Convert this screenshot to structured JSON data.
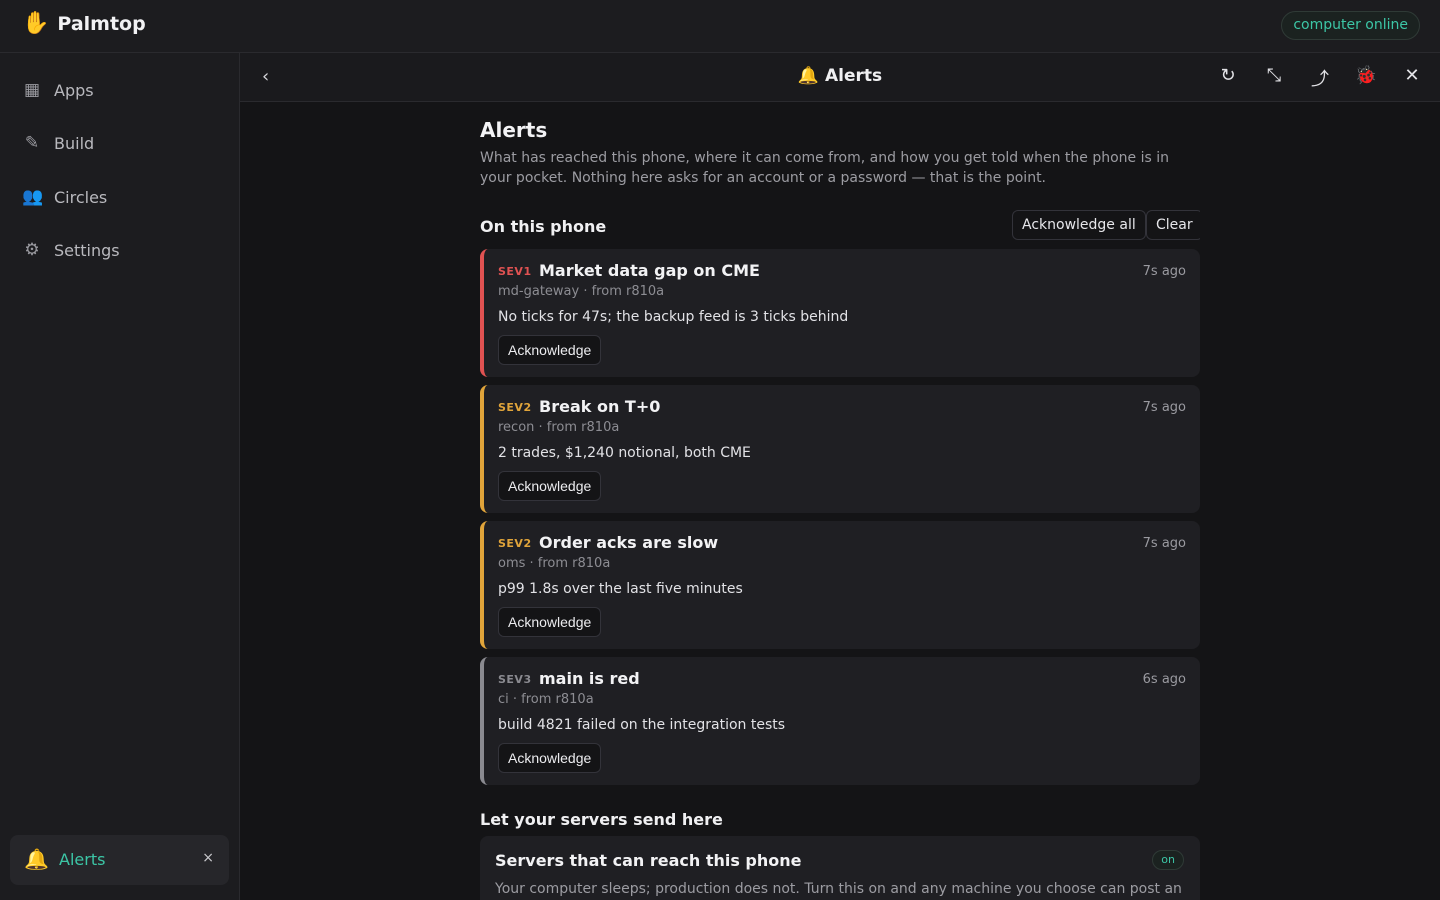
{
  "app": {
    "name": "Palmtop",
    "logo_icon": "✋",
    "status": "computer online"
  },
  "sidebar": {
    "items": [
      {
        "label": "Apps",
        "icon": "▦"
      },
      {
        "label": "Build",
        "icon": "✎"
      },
      {
        "label": "Circles",
        "icon": "👥"
      },
      {
        "label": "Settings",
        "icon": "⚙"
      }
    ],
    "open_app": {
      "label": "Alerts",
      "icon": "🔔",
      "close": "×"
    }
  },
  "panel": {
    "title": "🔔 Alerts",
    "back_icon": "‹",
    "tools": [
      "↻",
      "⤡",
      "⤴",
      "🐞",
      "✕"
    ]
  },
  "page": {
    "heading": "Alerts",
    "intro": "What has reached this phone, where it can come from, and how you get told when the phone is in your pocket. Nothing here asks for an account or a password — that is the point.",
    "on_phone_title": "On this phone",
    "ack_all_label": "Acknowledge all",
    "clear_label": "Clear",
    "alerts": [
      {
        "sev": "SEV1",
        "title": "Market data gap on CME",
        "time": "7s ago",
        "meta": "md-gateway · from r810a",
        "body": "No ticks for 47s; the backup feed is 3 ticks behind",
        "action": "Acknowledge",
        "color": "#e05252"
      },
      {
        "sev": "SEV2",
        "title": "Break on T+0",
        "time": "7s ago",
        "meta": "recon · from r810a",
        "body": "2 trades, $1,240 notional, both CME",
        "action": "Acknowledge",
        "color": "#e0a43a"
      },
      {
        "sev": "SEV2",
        "title": "Order acks are slow",
        "time": "7s ago",
        "meta": "oms · from r810a",
        "body": "p99 1.8s over the last five minutes",
        "action": "Acknowledge",
        "color": "#e0a43a"
      },
      {
        "sev": "SEV3",
        "title": "main is red",
        "time": "6s ago",
        "meta": "ci · from r810a",
        "body": "build 4821 failed on the integration tests",
        "action": "Acknowledge",
        "color": "#8a8a90"
      }
    ],
    "servers_section_title": "Let your servers send here",
    "servers_card": {
      "title": "Servers that can reach this phone",
      "badge": "on",
      "desc": "Your computer sleeps; production does not. Turn this on and any machine you choose can post an"
    }
  }
}
